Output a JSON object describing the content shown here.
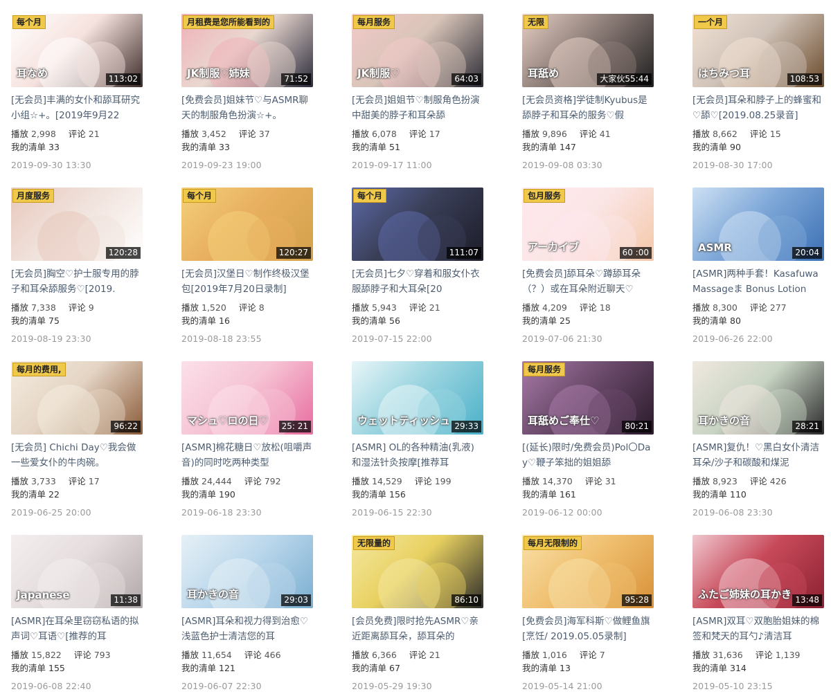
{
  "labels": {
    "play": "播放",
    "comment": "评论",
    "mylist": "我的清单"
  },
  "colors": {
    "badge": "#f0c84a",
    "title_link": "#4c5c70",
    "date": "#999999"
  },
  "videos": [
    {
      "badge": "每个月",
      "duration": "113:02",
      "title": "[无会员]丰满的女仆和舔耳研究小组☆+。[2019年9月22",
      "plays": "2,998",
      "comments": "21",
      "mylist": "33",
      "date": "2019-09-30 13:30",
      "overlay": "耳なめ",
      "palette": [
        "#f6e2de",
        "#3a2a28",
        "#ffffff"
      ]
    },
    {
      "badge": "月租费是您所能看到的",
      "duration": "71:52",
      "title": "[免费会员]姐妹节♡与ASMR聊天的制服角色扮演☆+。",
      "plays": "3,452",
      "comments": "37",
      "mylist": "33",
      "date": "2019-09-23 19:00",
      "overlay": "JK制服♡姉妹",
      "palette": [
        "#e9d8d0",
        "#2a2a3a",
        "#f0b0b8"
      ]
    },
    {
      "badge": "每月服务",
      "duration": "64:03",
      "title": "[无会员]姐姐节♡制服角色扮演中甜美的脖子和耳朵舔",
      "plays": "6,078",
      "comments": "17",
      "mylist": "51",
      "date": "2019-09-17 11:00",
      "overlay": "JK制服♡",
      "palette": [
        "#d8c4b8",
        "#2b2b35",
        "#f3c9c9"
      ]
    },
    {
      "badge": "无限",
      "duration": "大家伙55:44",
      "title": "[无会员资格]学徒制Kyubus是舔脖子和耳朵的服务♡假",
      "plays": "9,896",
      "comments": "41",
      "mylist": "147",
      "date": "2019-09-08 03:30",
      "overlay": "耳舐め",
      "palette": [
        "#8d7d78",
        "#1f1f1f",
        "#e6cfc4"
      ]
    },
    {
      "badge": "一个月",
      "duration": "108:53",
      "title": "[无会员]耳朵和脖子上的蜂蜜和♡舔♡[2019.08.25录音]",
      "plays": "8,662",
      "comments": "15",
      "mylist": "90",
      "date": "2019-08-30 17:00",
      "overlay": "はちみつ耳",
      "palette": [
        "#cfc2b8",
        "#6a4a2a",
        "#f2e2d4"
      ]
    },
    {
      "badge": "月度服务",
      "duration": "120:28",
      "title": "[无会员]胸空♡护士服专用的脖子和耳朵舔服务♡[2019.",
      "plays": "7,338",
      "comments": "9",
      "mylist": "75",
      "date": "2019-08-19 23:30",
      "overlay": "",
      "palette": [
        "#f0e2dc",
        "#ffffff",
        "#e8c8bc"
      ]
    },
    {
      "badge": "每个月",
      "duration": "120:27",
      "title": "[无会员]汉堡日♡制作终极汉堡包[2019年7月20日录制]",
      "plays": "1,520",
      "comments": "8",
      "mylist": "16",
      "date": "2019-08-18 23:55",
      "overlay": "",
      "palette": [
        "#e8b060",
        "#d2a04a",
        "#f4d07a"
      ]
    },
    {
      "badge": "每个月",
      "duration": "111:07",
      "title": "[无会员]七夕♡穿着和服女仆衣服舔脖子和大耳朵[20",
      "plays": "5,943",
      "comments": "21",
      "mylist": "56",
      "date": "2019-07-15 22:00",
      "overlay": "",
      "palette": [
        "#3a3f58",
        "#1c1c28",
        "#5c6aa8"
      ]
    },
    {
      "badge": "包月服务",
      "duration": "60 :00",
      "title": "[免费会员]舔耳朵♡蹲舔耳朵（？）或在耳朵附近聊天♡",
      "plays": "4,209",
      "comments": "18",
      "mylist": "25",
      "date": "2019-07-06 21:30",
      "overlay": "アーカイブ",
      "palette": [
        "#fbe6e6",
        "#f4c7a8",
        "#ffe8ee"
      ]
    },
    {
      "badge": "",
      "duration": "20:04",
      "title": "[ASMR]两种手套！Kasafuwa Massageま Bonus Lotion",
      "plays": "8,300",
      "comments": "277",
      "mylist": "80",
      "date": "2019-06-26 22:00",
      "overlay": "ASMR",
      "palette": [
        "#7fa8d8",
        "#3a6fb4",
        "#cde0f4"
      ]
    },
    {
      "badge": "每月的费用,",
      "duration": "96:22",
      "title": "[无会员] Chichi Day♡我会做一些爱女仆的牛肉碗。",
      "plays": "3,733",
      "comments": "17",
      "mylist": "22",
      "date": "2019-06-25 20:00",
      "overlay": "",
      "palette": [
        "#e4d4c4",
        "#8a5a38",
        "#f4ecdf"
      ]
    },
    {
      "badge": "",
      "duration": "25: 21",
      "title": "[ASMR]棉花糖日♡放松(咀嚼声音)的同时吃两种类型",
      "plays": "24,444",
      "comments": "792",
      "mylist": "190",
      "date": "2019-06-18 23:30",
      "overlay": "マシュ♡ロの日♡",
      "palette": [
        "#f6c4d4",
        "#e86ca0",
        "#fbe0ea"
      ]
    },
    {
      "badge": "",
      "duration": "29:33",
      "title": "[ASMR] OL的各种精油(乳液)和湿法针灸按摩[推荐耳",
      "plays": "14,529",
      "comments": "199",
      "mylist": "156",
      "date": "2019-06-15 22:30",
      "overlay": "ウェットティッシュ",
      "palette": [
        "#9ad4e0",
        "#4ab0c8",
        "#e8f6f8"
      ]
    },
    {
      "badge": "每月服务",
      "duration": "80:21",
      "title": "[(延长)限时/免费会员)Pol〇Day♡鞭子笨拙的姐姐舔",
      "plays": "14,370",
      "comments": "31",
      "mylist": "161",
      "date": "2019-06-12 00:00",
      "overlay": "耳舐めご奉仕♡",
      "palette": [
        "#6a4a6a",
        "#2a1a2a",
        "#a87aa8"
      ]
    },
    {
      "badge": "",
      "duration": "28:21",
      "title": "[ASMR]复仇！♡黑白女仆清洁耳朵/沙子和碳酸和煤泥",
      "plays": "8,923",
      "comments": "426",
      "mylist": "110",
      "date": "2019-06-08 23:30",
      "overlay": "耳かきの音",
      "palette": [
        "#c8d4c4",
        "#2a2a2a",
        "#f0e8e0"
      ]
    },
    {
      "badge": "",
      "duration": "11:38",
      "title": "[ASMR]在耳朵里窃窃私语的拟声词♡耳语♡[推荐的耳",
      "plays": "15,822",
      "comments": "793",
      "mylist": "155",
      "date": "2019-06-08 22:40",
      "overlay": "Japanese",
      "palette": [
        "#e6dede",
        "#b0a8a8",
        "#f4eeee"
      ]
    },
    {
      "badge": "",
      "duration": "29:03",
      "title": "[ASMR]耳朵和视力得到治愈♡浅蓝色护士清洁您的耳",
      "plays": "11,654",
      "comments": "466",
      "mylist": "121",
      "date": "2019-06-07 22:30",
      "overlay": "耳かきの音",
      "palette": [
        "#bcd8ec",
        "#7aaed0",
        "#e6f0f6"
      ]
    },
    {
      "badge": "无限量的",
      "duration": "86:10",
      "title": "[会员免费]限时抢先ASMR♡亲近距离舔耳朵，舔耳朵的",
      "plays": "6,366",
      "comments": "21",
      "mylist": "67",
      "date": "2019-05-29 19:30",
      "overlay": "",
      "palette": [
        "#e8d060",
        "#2a2a2a",
        "#f4e8a0"
      ]
    },
    {
      "badge": "每月无限制的",
      "duration": "95:28",
      "title": "[免费会员]海军科斯♡做鲤鱼旗[烹饪/ 2019.05.05录制]",
      "plays": "1,016",
      "comments": "7",
      "mylist": "13",
      "date": "2019-05-14 21:00",
      "overlay": "",
      "palette": [
        "#f0c070",
        "#d89038",
        "#f8e0a8"
      ]
    },
    {
      "badge": "",
      "duration": "13:48",
      "title": "[ASMR]双耳♡双胞胎姐妹的棉签和梵天的耳勺♪清洁耳",
      "plays": "31,636",
      "comments": "1,139",
      "mylist": "314",
      "date": "2019-05-10 23:15",
      "overlay": "ふたご姉妹の耳かき",
      "palette": [
        "#c84a5a",
        "#8a2030",
        "#f0c8d0"
      ]
    }
  ]
}
